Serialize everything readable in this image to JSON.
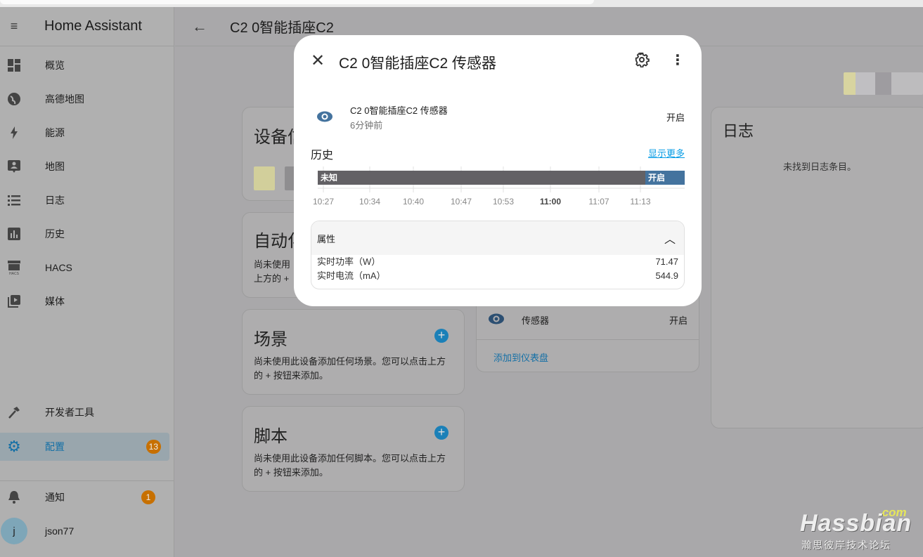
{
  "app_title": "Home Assistant",
  "sidebar": {
    "items": [
      {
        "label": "概览",
        "icon": "dashboard-icon"
      },
      {
        "label": "高德地图",
        "icon": "globe-icon"
      },
      {
        "label": "能源",
        "icon": "lightning-icon"
      },
      {
        "label": "地图",
        "icon": "map-person-icon"
      },
      {
        "label": "日志",
        "icon": "list-icon"
      },
      {
        "label": "历史",
        "icon": "bar-chart-icon"
      },
      {
        "label": "HACS",
        "icon": "hacs-store-icon"
      },
      {
        "label": "媒体",
        "icon": "media-play-icon"
      }
    ],
    "dev_tools": "开发者工具",
    "config": {
      "label": "配置",
      "badge": "13"
    },
    "notifications": {
      "label": "通知",
      "badge": "1"
    },
    "user": {
      "name": "json77",
      "initial": "j"
    }
  },
  "header": {
    "title": "C2 0智能插座C2"
  },
  "cards": {
    "device_info": "设备信",
    "automation": {
      "title": "自动化",
      "desc1": "尚未使用",
      "desc2": "上方的 +"
    },
    "scenes": {
      "title": "场景",
      "desc": "尚未使用此设备添加任何场景。您可以点击上方的 + 按钮来添加。"
    },
    "scripts": {
      "title": "脚本",
      "desc": "尚未使用此设备添加任何脚本。您可以点击上方的 + 按钮来添加。"
    },
    "sensors": {
      "entity": "传感器",
      "state": "开启",
      "add": "添加到仪表盘"
    },
    "logbook": {
      "title": "日志",
      "empty": "未找到日志条目。"
    }
  },
  "dialog": {
    "title": "C2 0智能插座C2 传感器",
    "entity_name": "C2 0智能插座C2 传感器",
    "last_changed": "6分钟前",
    "state": "开启",
    "history_label": "历史",
    "show_more": "显示更多",
    "timeline": {
      "ticks": [
        "10:27",
        "10:34",
        "10:40",
        "10:47",
        "10:53",
        "11:00",
        "11:07",
        "11:13"
      ],
      "bold_tick": "11:00",
      "segments": [
        {
          "label": "未知",
          "color": "#636165"
        },
        {
          "label": "开启",
          "color": "#44739e"
        }
      ]
    },
    "attributes": {
      "title": "属性",
      "rows": [
        {
          "name": "实时功率（W）",
          "value": "71.47"
        },
        {
          "name": "实时电流（mA）",
          "value": "544.9"
        }
      ]
    }
  },
  "watermark": {
    "com": ".com",
    "brand": "Hassbian",
    "sub": "瀚思彼岸技术论坛"
  }
}
